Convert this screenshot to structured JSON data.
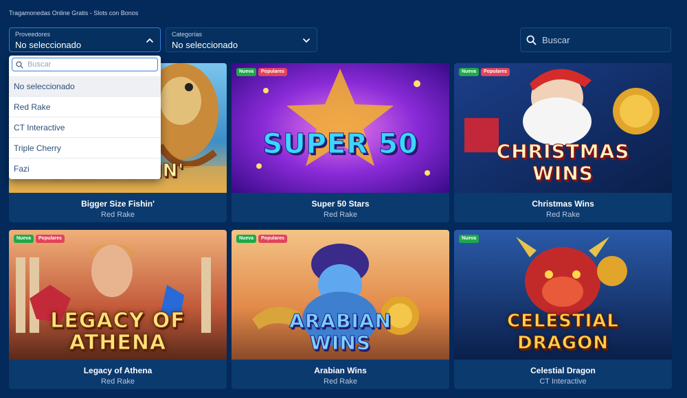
{
  "page": {
    "title": "Tragamonedas Online Gratis - Slots con Bonos"
  },
  "filters": {
    "providers": {
      "label": "Proveedores",
      "value": "No seleccionado"
    },
    "categories": {
      "label": "Categorías",
      "value": "No seleccionado"
    },
    "search": {
      "placeholder": "Buscar"
    }
  },
  "dropdown": {
    "search_placeholder": "Buscar",
    "options": [
      "No seleccionado",
      "Red Rake",
      "CT Interactive",
      "Triple Cherry",
      "Fazi"
    ]
  },
  "badges": {
    "new": "Nueva",
    "popular": "Populares"
  },
  "games": [
    {
      "name": "Bigger Size Fishin'",
      "provider": "Red Rake",
      "art": "SIZE FISHIN'",
      "badges": []
    },
    {
      "name": "Super 50 Stars",
      "provider": "Red Rake",
      "art": "SUPER 50",
      "badges": [
        "new",
        "popular"
      ]
    },
    {
      "name": "Christmas Wins",
      "provider": "Red Rake",
      "art": "CHRISTMAS WINS",
      "badges": [
        "new",
        "popular"
      ]
    },
    {
      "name": "Legacy of Athena",
      "provider": "Red Rake",
      "art": "LEGACY OF ATHENA",
      "badges": [
        "new",
        "popular"
      ]
    },
    {
      "name": "Arabian Wins",
      "provider": "Red Rake",
      "art": "ARABIAN WINS",
      "badges": [
        "new",
        "popular"
      ]
    },
    {
      "name": "Celestial Dragon",
      "provider": "CT Interactive",
      "art": "CELESTIAL DRAGON",
      "badges": [
        "new"
      ]
    }
  ],
  "colors": {
    "background": "#032a5a",
    "card": "#0b3a6f",
    "badge_new": "#1fa94a",
    "badge_popular": "#e2445c"
  }
}
